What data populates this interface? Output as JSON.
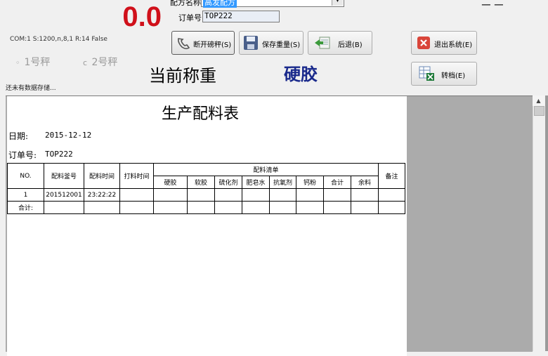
{
  "weight": {
    "value": "0.0",
    "com_status": "COM:1 S:1200,n,8,1 R:14  False"
  },
  "scales": [
    {
      "label": "1号秤",
      "selected": true
    },
    {
      "label": "2号秤",
      "selected": false
    }
  ],
  "formula": {
    "label": "配方名称:",
    "value": "高发配方"
  },
  "order": {
    "label": "订单号:",
    "value": "TOP222"
  },
  "top_right_glyph": "ㄧㄧ",
  "buttons": {
    "disconnect": "断开磅秤(S)",
    "save": "保存重量(S)",
    "back": "后退(B)",
    "exit": "退出系统(E)",
    "transfer": "转档(E)"
  },
  "current_weight_title": "当前称重",
  "current_material": "硬胶",
  "status_msg": "还未有数据存储...",
  "report": {
    "title": "生产配料表",
    "date_label": "日期:",
    "date_value": "2015-12-12",
    "order_label": "订单号:",
    "order_value": "TOP222",
    "headers": {
      "no": "NO.",
      "batch_no": "配料釜号",
      "batch_time": "配料时间",
      "pour_time": "打料时间",
      "materials_group": "配料清单",
      "remark": "备注"
    },
    "material_cols": [
      "硬胶",
      "软胶",
      "硫化剂",
      "肥皂水",
      "抗氧剂",
      "钙粉",
      "合计",
      "余料"
    ],
    "rows": [
      {
        "no": "1",
        "batch_no": "201512001",
        "batch_time": "23:22:22",
        "pour_time": "",
        "materials": [
          "",
          "",
          "",
          "",
          "",
          "",
          "",
          ""
        ],
        "remark": ""
      }
    ],
    "total_label": "合计:"
  },
  "colors": {
    "weight": "#d0101a",
    "material": "#1a2a8c",
    "selection": "#3399ff"
  }
}
